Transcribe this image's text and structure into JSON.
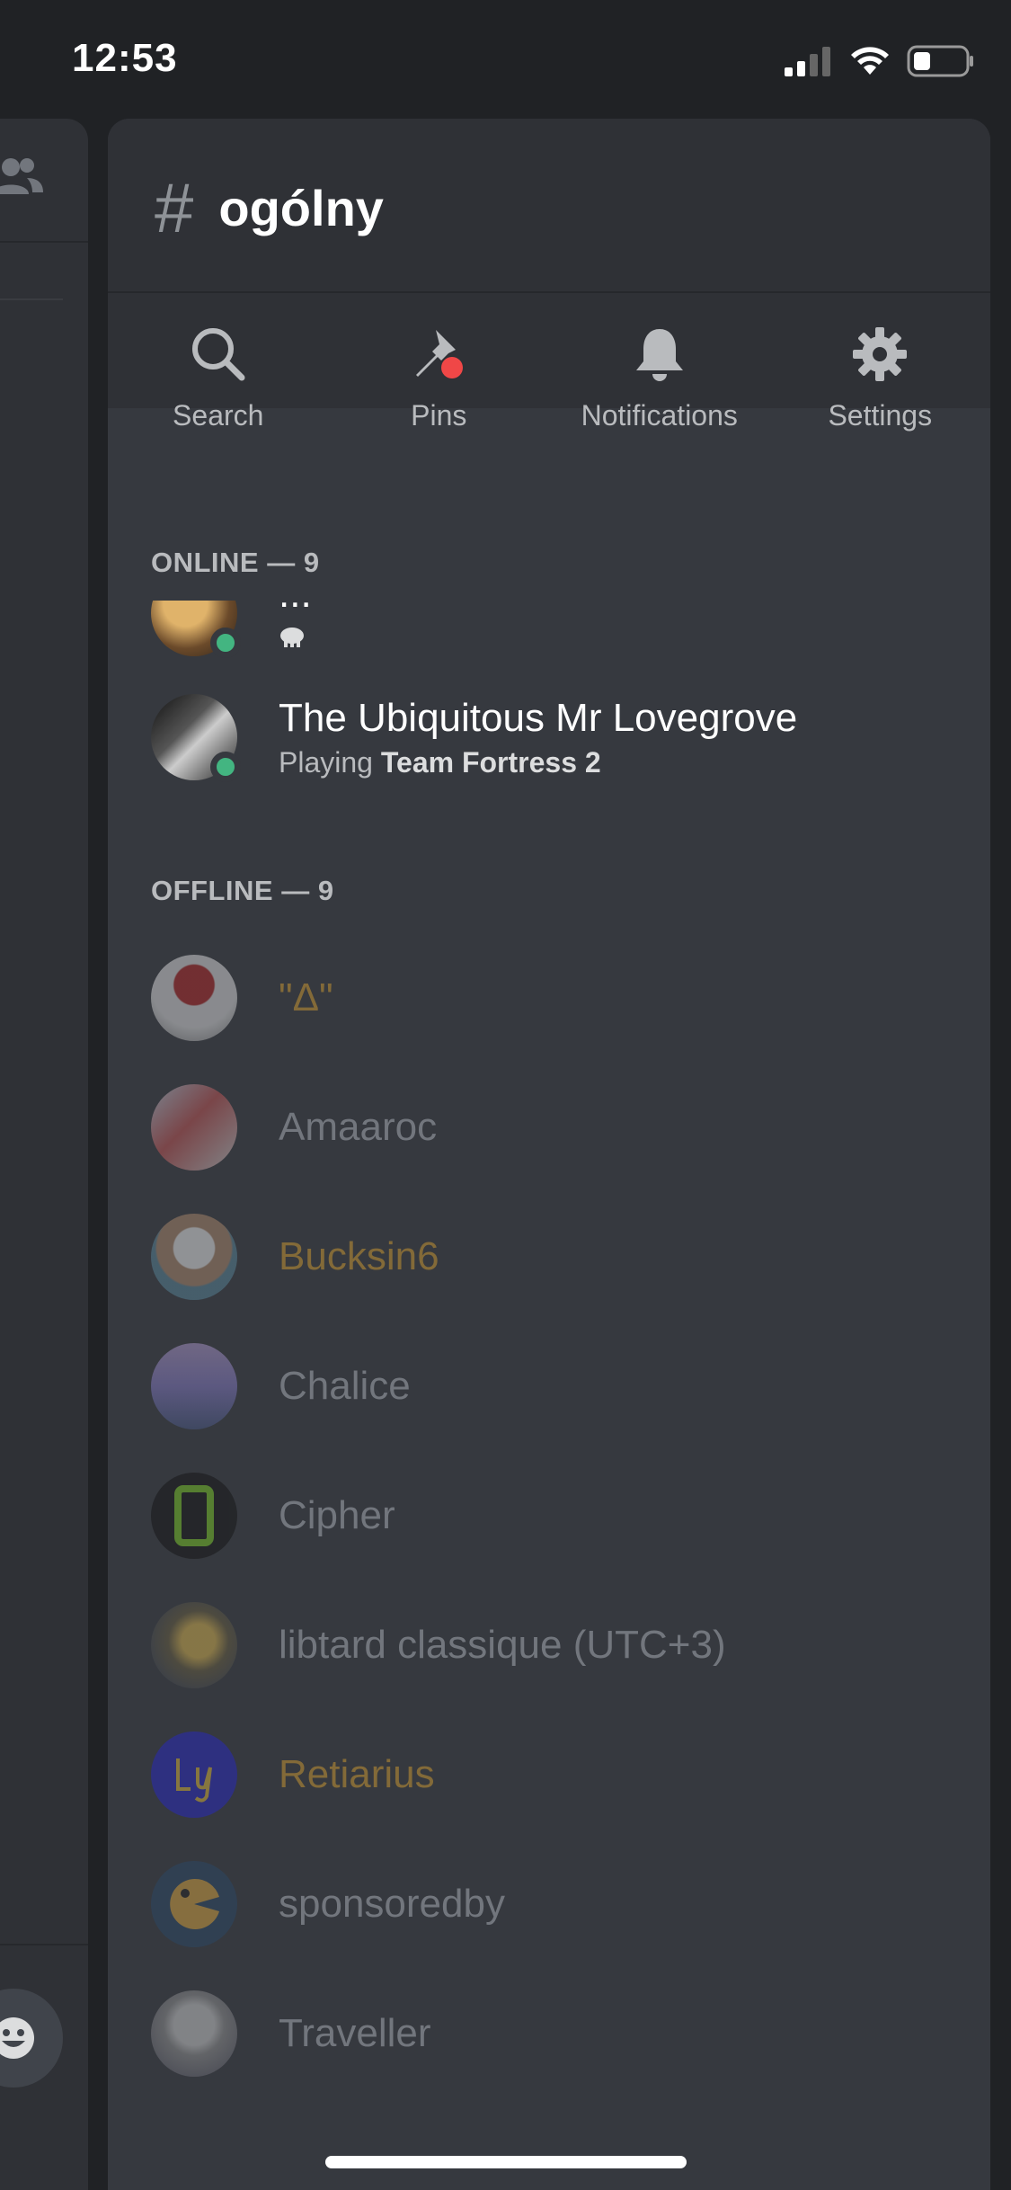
{
  "status_bar": {
    "time": "12:53"
  },
  "channel": {
    "name": "ogólny"
  },
  "actions": [
    {
      "label": "Search",
      "icon": "search-icon"
    },
    {
      "label": "Pins",
      "icon": "pin-icon"
    },
    {
      "label": "Notifications",
      "icon": "bell-icon"
    },
    {
      "label": "Settings",
      "icon": "gear-icon"
    }
  ],
  "online": {
    "title": "ONLINE — 9",
    "members": [
      {
        "name": "...",
        "sub": ""
      },
      {
        "name": "The Ubiquitous Mr Lovegrove",
        "sub_prefix": "Playing ",
        "sub_bold": "Team Fortress 2"
      }
    ]
  },
  "offline": {
    "title": "OFFLINE — 9",
    "members": [
      {
        "name": "\"Δ\"",
        "gold": true
      },
      {
        "name": "Amaaroc",
        "gold": false
      },
      {
        "name": "Bucksin6",
        "gold": true
      },
      {
        "name": "Chalice",
        "gold": false
      },
      {
        "name": "Cipher",
        "gold": false
      },
      {
        "name": "libtard classique (UTC+3)",
        "gold": false
      },
      {
        "name": "Retiarius",
        "gold": true
      },
      {
        "name": "sponsoredby",
        "gold": false
      },
      {
        "name": "Traveller",
        "gold": false
      }
    ]
  },
  "colors": {
    "online_status": "#43b581",
    "role_gold": "#836a38",
    "background": "#36393f"
  }
}
